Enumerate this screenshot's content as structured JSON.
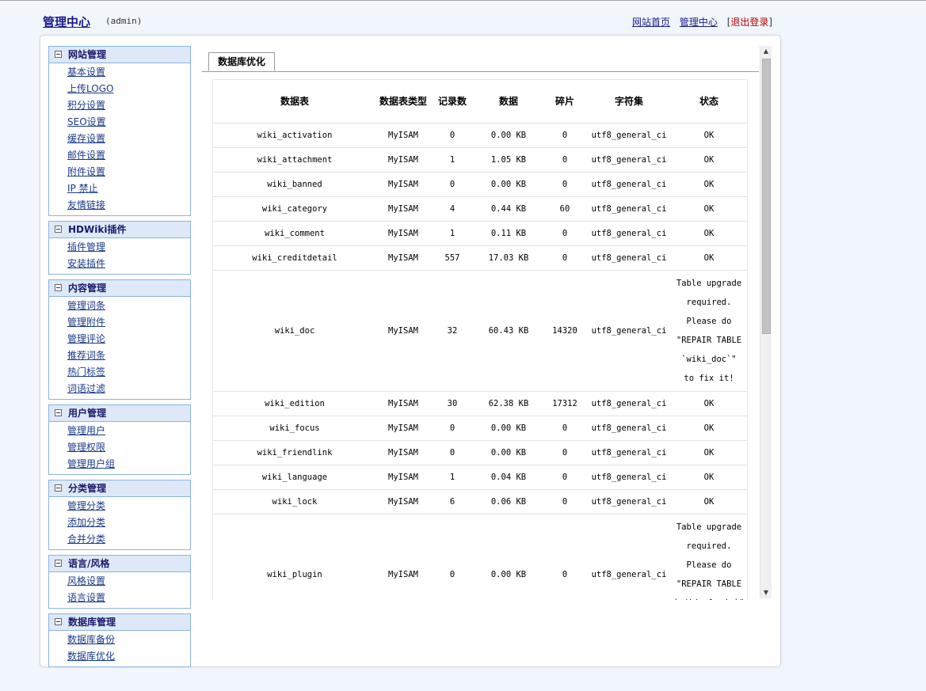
{
  "header": {
    "brand": "管理中心",
    "user": "(admin)",
    "links": {
      "home": "网站首页",
      "admin": "管理中心",
      "logout": "退出登录",
      "bracket_open": "[",
      "bracket_close": "]"
    }
  },
  "sidebar": {
    "groups": [
      {
        "title": "网站管理",
        "items": [
          "基本设置",
          "上传LOGO",
          "积分设置",
          "SEO设置",
          "缓存设置",
          "邮件设置",
          "附件设置",
          "IP 禁止",
          "友情链接"
        ]
      },
      {
        "title": "HDWiki插件",
        "items": [
          "插件管理",
          "安装插件"
        ]
      },
      {
        "title": "内容管理",
        "items": [
          "管理词条",
          "管理附件",
          "管理评论",
          "推荐词条",
          "热门标签",
          "词语过滤"
        ]
      },
      {
        "title": "用户管理",
        "items": [
          "管理用户",
          "管理权限",
          "管理用户组"
        ]
      },
      {
        "title": "分类管理",
        "items": [
          "管理分类",
          "添加分类",
          "合并分类"
        ]
      },
      {
        "title": "语言/风格",
        "items": [
          "风格设置",
          "语言设置"
        ]
      },
      {
        "title": "数据库管理",
        "items": [
          "数据库备份",
          "数据库优化"
        ]
      }
    ]
  },
  "tab": {
    "label": "数据库优化"
  },
  "table": {
    "headers": [
      "数据表",
      "数据表类型",
      "记录数",
      "数据",
      "碎片",
      "字符集",
      "状态"
    ],
    "rows": [
      [
        "wiki_activation",
        "MyISAM",
        "0",
        "0.00 KB",
        "0",
        "utf8_general_ci",
        "OK"
      ],
      [
        "wiki_attachment",
        "MyISAM",
        "1",
        "1.05 KB",
        "0",
        "utf8_general_ci",
        "OK"
      ],
      [
        "wiki_banned",
        "MyISAM",
        "0",
        "0.00 KB",
        "0",
        "utf8_general_ci",
        "OK"
      ],
      [
        "wiki_category",
        "MyISAM",
        "4",
        "0.44 KB",
        "60",
        "utf8_general_ci",
        "OK"
      ],
      [
        "wiki_comment",
        "MyISAM",
        "1",
        "0.11 KB",
        "0",
        "utf8_general_ci",
        "OK"
      ],
      [
        "wiki_creditdetail",
        "MyISAM",
        "557",
        "17.03 KB",
        "0",
        "utf8_general_ci",
        "OK"
      ],
      [
        "wiki_doc",
        "MyISAM",
        "32",
        "60.43 KB",
        "14320",
        "utf8_general_ci",
        "Table upgrade required. Please do \"REPAIR TABLE `wiki_doc`\" to fix it!"
      ],
      [
        "wiki_edition",
        "MyISAM",
        "30",
        "62.38 KB",
        "17312",
        "utf8_general_ci",
        "OK"
      ],
      [
        "wiki_focus",
        "MyISAM",
        "0",
        "0.00 KB",
        "0",
        "utf8_general_ci",
        "OK"
      ],
      [
        "wiki_friendlink",
        "MyISAM",
        "0",
        "0.00 KB",
        "0",
        "utf8_general_ci",
        "OK"
      ],
      [
        "wiki_language",
        "MyISAM",
        "1",
        "0.04 KB",
        "0",
        "utf8_general_ci",
        "OK"
      ],
      [
        "wiki_lock",
        "MyISAM",
        "6",
        "0.06 KB",
        "0",
        "utf8_general_ci",
        "OK"
      ],
      [
        "wiki_plugin",
        "MyISAM",
        "0",
        "0.00 KB",
        "0",
        "utf8_general_ci",
        "Table upgrade required. Please do \"REPAIR TABLE `wiki_plugin`\" to fix it!"
      ]
    ]
  },
  "icons": {
    "toggle": "collapse-minus-icon",
    "scroll_up": "scroll-up-arrow-icon",
    "scroll_down": "scroll-down-arrow-icon"
  }
}
